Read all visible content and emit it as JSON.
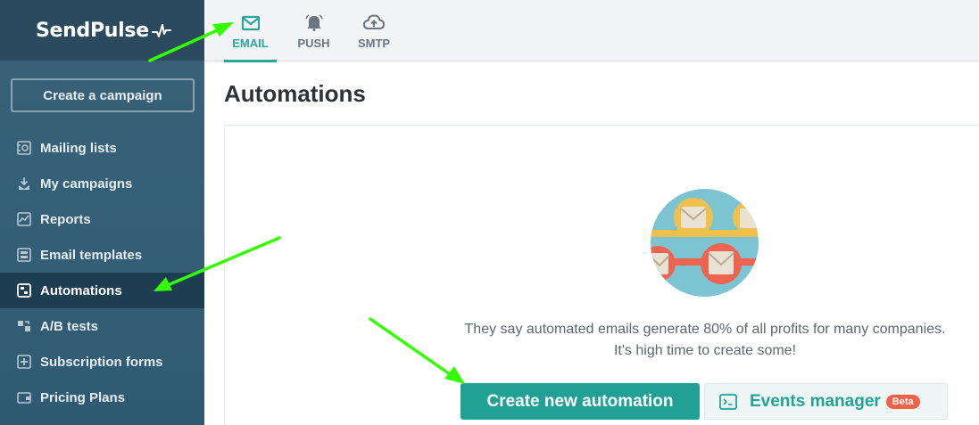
{
  "app": {
    "logo_text": "SendPulse"
  },
  "sidebar": {
    "create_button": "Create a campaign",
    "items": [
      {
        "label": "Mailing lists",
        "icon": "mailing-list-icon"
      },
      {
        "label": "My campaigns",
        "icon": "campaigns-icon"
      },
      {
        "label": "Reports",
        "icon": "reports-icon"
      },
      {
        "label": "Email templates",
        "icon": "templates-icon"
      },
      {
        "label": "Automations",
        "icon": "automations-icon",
        "active": true
      },
      {
        "label": "A/B tests",
        "icon": "ab-tests-icon"
      },
      {
        "label": "Subscription forms",
        "icon": "forms-icon"
      },
      {
        "label": "Pricing Plans",
        "icon": "pricing-icon"
      }
    ]
  },
  "tabs": [
    {
      "label": "EMAIL",
      "icon": "envelope-icon",
      "active": true
    },
    {
      "label": "PUSH",
      "icon": "bell-icon"
    },
    {
      "label": "SMTP",
      "icon": "cloud-upload-icon"
    }
  ],
  "main": {
    "title": "Automations",
    "message_line1": "They say automated emails generate 80% of all profits for many companies.",
    "message_line2": "It's high time to create some!",
    "primary_button": "Create new automation",
    "secondary_button": "Events manager",
    "beta_badge": "Beta"
  },
  "colors": {
    "accent": "#21a195",
    "sidebar": "#356077",
    "sidebar_active": "#1d3d50",
    "beta": "#f26149",
    "annotation_arrow": "#33ff00"
  }
}
